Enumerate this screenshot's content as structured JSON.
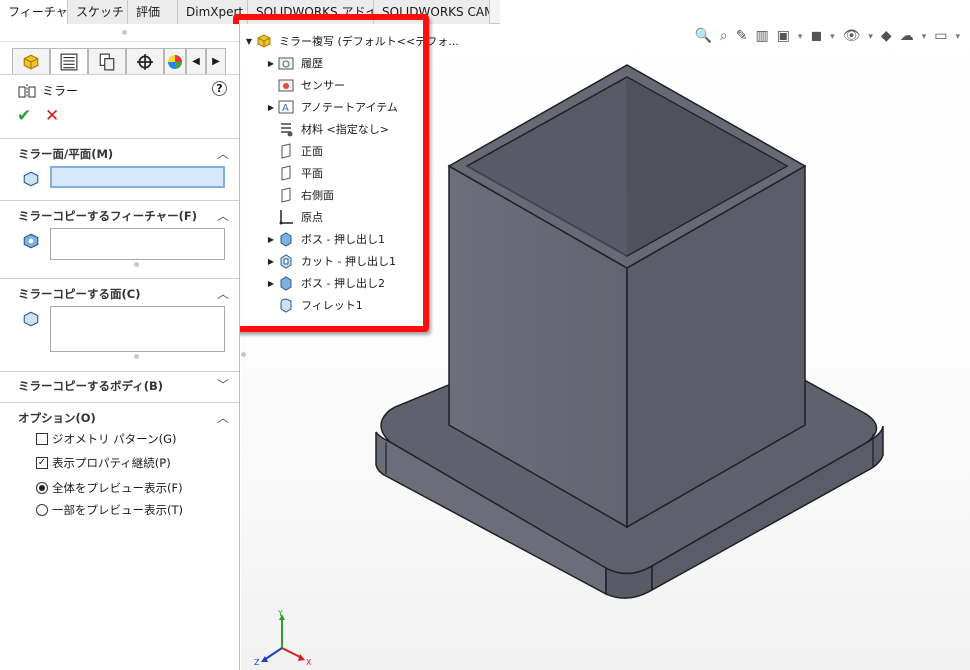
{
  "tabs": [
    "フィーチャー",
    "スケッチ",
    "評価",
    "DimXpert",
    "SOLIDWORKS アドイン",
    "SOLIDWORKS CAM"
  ],
  "panel": {
    "title": "ミラー",
    "help": "?",
    "ok": "✔",
    "cancel": "✕",
    "sections": {
      "mirror_plane": "ミラー面/平面(M)",
      "features": "ミラーコピーするフィーチャー(F)",
      "faces": "ミラーコピーする面(C)",
      "bodies": "ミラーコピーするボディ(B)",
      "options": "オプション(O)"
    },
    "options": {
      "geometry_pattern": "ジオメトリ パターン(G)",
      "propagate_props": "表示プロパティ継続(P)",
      "full_preview": "全体をプレビュー表示(F)",
      "partial_preview": "一部をプレビュー表示(T)"
    },
    "state": {
      "geometry_pattern": false,
      "propagate_props": true,
      "preview": "full"
    }
  },
  "tree": {
    "root": "ミラー複写 (デフォルト<<デフォ...",
    "items": [
      "履歴",
      "センサー",
      "アノテートアイテム",
      "材料 <指定なし>",
      "正面",
      "平面",
      "右側面",
      "原点",
      "ボス - 押し出し1",
      "カット - 押し出し1",
      "ボス - 押し出し2",
      "フィレット1"
    ]
  },
  "triad": {
    "x": "X",
    "y": "Y",
    "z": "Z"
  },
  "colors": {
    "highlight": "#ff0d0d",
    "part": "#62646f",
    "ok": "#2ca02c",
    "cancel": "#d61a1a"
  }
}
